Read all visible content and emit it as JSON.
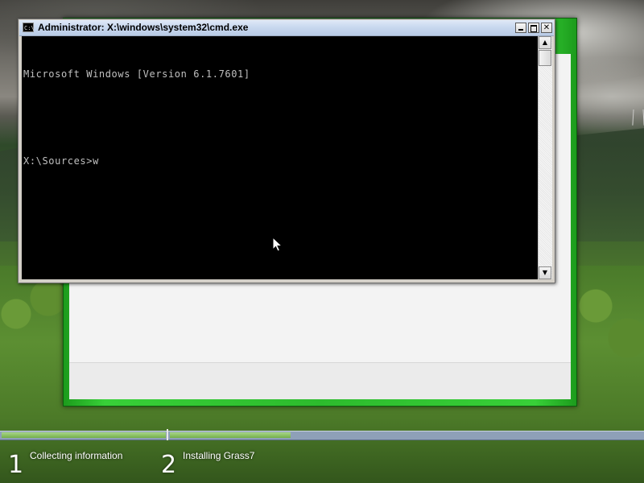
{
  "cmd_window": {
    "title": "Administrator: X:\\windows\\system32\\cmd.exe",
    "icon_label": "C:\\",
    "console_lines": [
      "Microsoft Windows [Version 6.1.7601]",
      "",
      "X:\\Sources>w"
    ],
    "buttons": {
      "close_glyph": "✕"
    },
    "scrollbar": {
      "up_glyph": "▲",
      "down_glyph": "▼"
    }
  },
  "setup_progress": {
    "steps": [
      {
        "number": "1",
        "label": "Collecting information"
      },
      {
        "number": "2",
        "label": "Installing Grass7"
      }
    ]
  },
  "colors": {
    "setup_frame": "#2dbb2d",
    "console_bg": "#000000",
    "console_text": "#c0c0c0",
    "progress_fill": "#74b04a"
  }
}
